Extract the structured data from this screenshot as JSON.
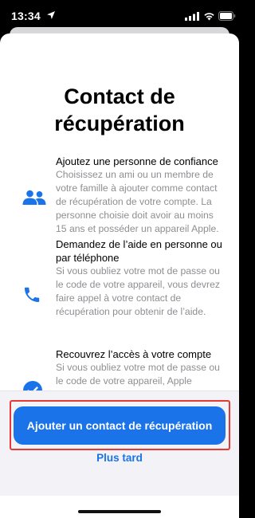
{
  "status_bar": {
    "time": "13:34"
  },
  "title": "Contact de récupération",
  "features": [
    {
      "heading": "Ajoutez une personne de confiance",
      "body": "Choisissez un ami ou un membre de votre famille à ajouter comme contact de récupération de votre compte. La personne choisie doit avoir au moins 15 ans et posséder un appareil Apple.",
      "icon": "people-icon"
    },
    {
      "heading": "Demandez de l’aide en personne ou par téléphone",
      "body": "Si vous oubliez votre mot de passe ou le code de votre appareil, vous devrez faire appel à votre contact de récupération pour obtenir de l’aide.",
      "icon": "phone-icon"
    },
    {
      "heading": "Recouvrez l’accès à votre compte",
      "body": "Si vous oubliez votre mot de passe ou le code de votre appareil, Apple",
      "icon": "check-icon"
    }
  ],
  "actions": {
    "primary": "Ajouter un contact de récupération",
    "secondary": "Plus tard"
  },
  "colors": {
    "accent": "#1a73e8",
    "highlight": "#e53935"
  }
}
